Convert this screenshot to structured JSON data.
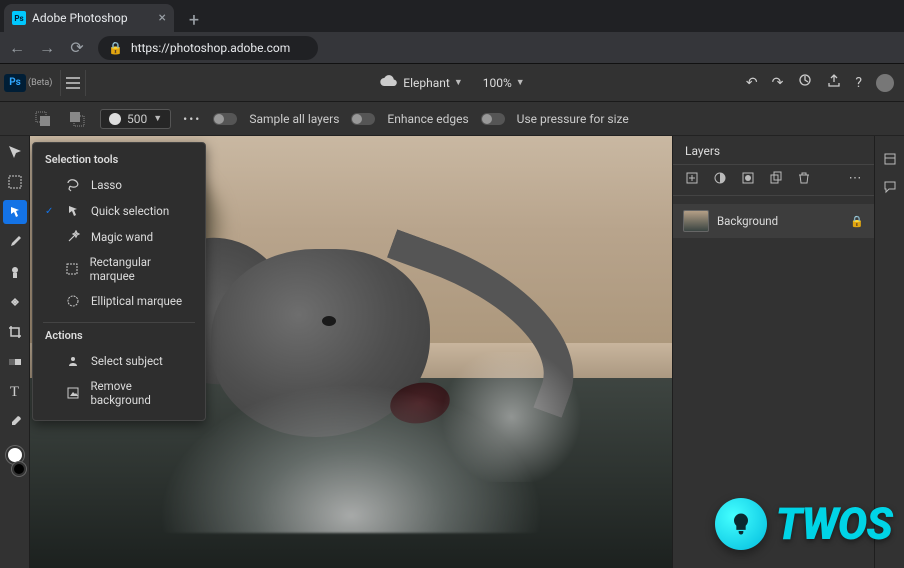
{
  "browser": {
    "tab_title": "Adobe Photoshop",
    "tab_favicon_text": "Ps",
    "url": "https://photoshop.adobe.com"
  },
  "app": {
    "logo_text": "Ps",
    "beta_label": "(Beta)",
    "filename": "Elephant",
    "zoom": "100%"
  },
  "options_bar": {
    "brush_size": "500",
    "toggle1_label": "Sample all layers",
    "toggle2_label": "Enhance edges",
    "toggle3_label": "Use pressure for size"
  },
  "tools_popup": {
    "header1": "Selection tools",
    "items": [
      {
        "icon": "lasso",
        "label": "Lasso",
        "checked": false
      },
      {
        "icon": "quick-select",
        "label": "Quick selection",
        "checked": true
      },
      {
        "icon": "magic-wand",
        "label": "Magic wand",
        "checked": false
      },
      {
        "icon": "rect-marquee",
        "label": "Rectangular marquee",
        "checked": false
      },
      {
        "icon": "ellipse-marquee",
        "label": "Elliptical marquee",
        "checked": false
      }
    ],
    "header2": "Actions",
    "actions": [
      {
        "icon": "select-subject",
        "label": "Select subject"
      },
      {
        "icon": "remove-bg",
        "label": "Remove background"
      }
    ]
  },
  "layers_panel": {
    "title": "Layers",
    "layer_name": "Background"
  },
  "watermark": {
    "text": "TWOS"
  }
}
